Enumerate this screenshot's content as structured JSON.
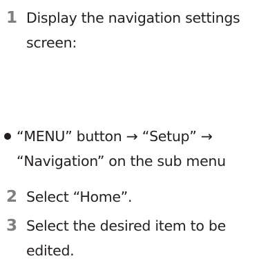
{
  "steps": [
    {
      "number": "1",
      "lines": [
        "Display the navigation settings",
        "screen:"
      ]
    },
    {
      "number": "2",
      "lines": [
        "Select “Home”."
      ]
    },
    {
      "number": "3",
      "lines": [
        "Select the desired item to be",
        "edited."
      ]
    }
  ],
  "bullet": {
    "lines": [
      "“MENU” button → “Setup” →",
      "“Navigation” on the sub menu"
    ]
  }
}
